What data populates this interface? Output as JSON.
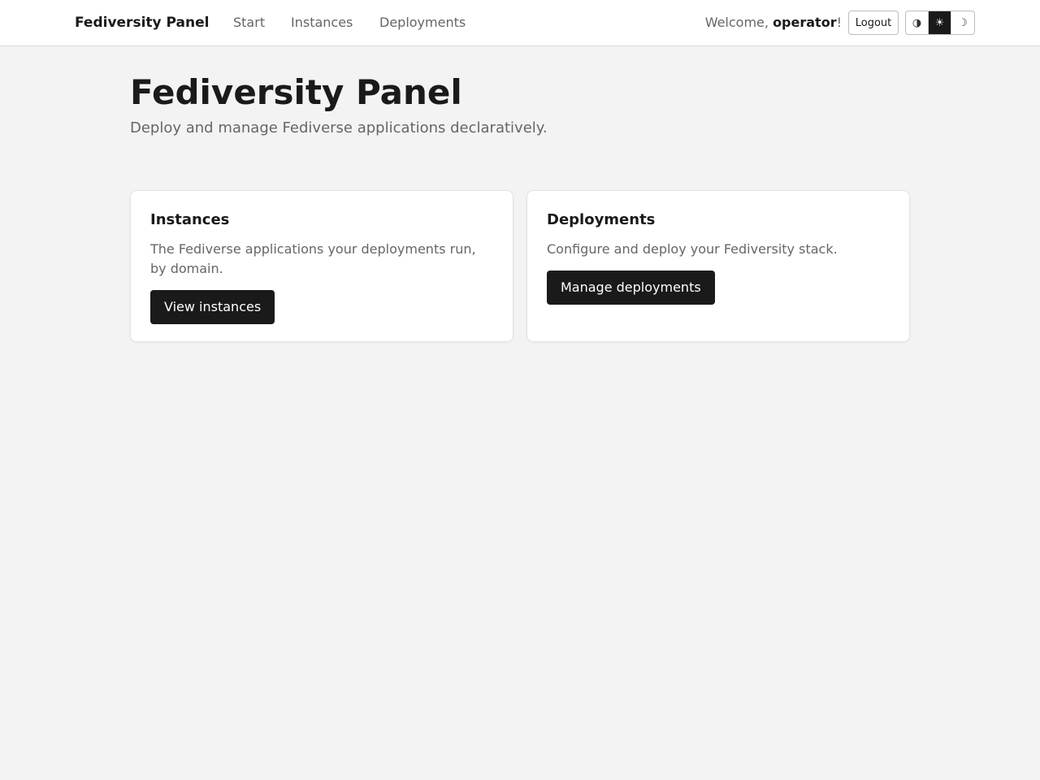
{
  "nav": {
    "brand": "Fediversity Panel",
    "links": [
      "Start",
      "Instances",
      "Deployments"
    ],
    "welcome_prefix": "Welcome, ",
    "username": "operator",
    "welcome_suffix": "!",
    "logout_label": "Logout",
    "theme_options": [
      {
        "icon": "auto-theme-icon",
        "glyph": "◑"
      },
      {
        "icon": "sun-icon",
        "glyph": "☀"
      },
      {
        "icon": "moon-icon",
        "glyph": "☽"
      }
    ],
    "active_theme": "sun-icon"
  },
  "hero": {
    "title": "Fediversity Panel",
    "subtitle": "Deploy and manage Fediverse applications declaratively."
  },
  "cards": [
    {
      "title": "Instances",
      "text": "The Fediverse applications your deployments run, by domain.",
      "button": "View instances"
    },
    {
      "title": "Deployments",
      "text": "Configure and deploy your Fediversity stack.",
      "button": "Manage deployments"
    }
  ],
  "colors": {
    "background": "#f3f3f3",
    "surface": "#ffffff",
    "primary": "#1a1a1a",
    "muted_text": "#666666"
  }
}
